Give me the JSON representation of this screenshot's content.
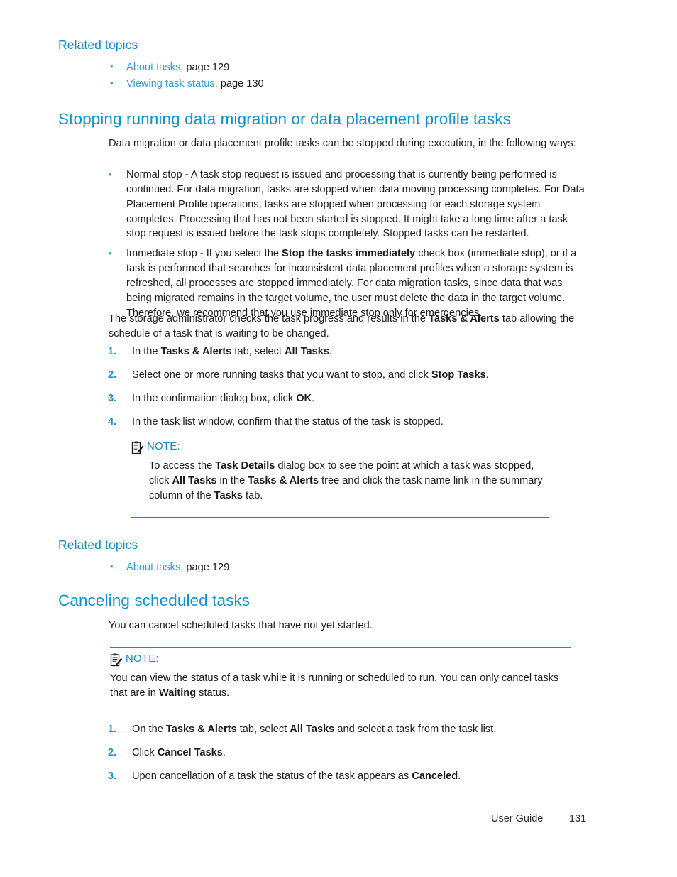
{
  "page": {
    "footer_label": "User Guide",
    "footer_page_number": "131"
  },
  "colors": {
    "heading_blue": "#0b95d4",
    "link_blue": "#2ba0dd",
    "rule_blue": "#0b8ecb",
    "step_number_blue": "#1a93d2",
    "body_text": "#1c1c1c"
  },
  "related_topics_top": {
    "heading": "Related topics",
    "items": [
      {
        "bullet": "•",
        "link": "About tasks",
        "suffix": ", page 129"
      },
      {
        "bullet": "•",
        "link": "Viewing task status",
        "suffix": ", page 130"
      }
    ]
  },
  "section_stopping": {
    "heading": "Stopping running data migration or data placement profile tasks",
    "intro": "Data migration or data placement profile tasks can be stopped during execution, in the following ways:",
    "bullets": [
      {
        "bullet": "•",
        "text": "Normal stop - A task stop request is issued and processing that is currently being performed is continued. For data migration, tasks are stopped when data moving processing completes. For Data Placement Profile operations, tasks are stopped when processing for each storage system completes. Processing that has not been started is stopped. It might take a long time after a task stop request is issued before the task stops completely. Stopped tasks can be restarted."
      },
      {
        "bullet": "•",
        "part1": "Immediate stop - If you select the ",
        "bold1": "Stop the tasks immediately",
        "part2": " check box (immediate stop), or if a task is performed that searches for inconsistent data placement profiles when a storage system is refreshed, all processes are stopped immediately. For data migration tasks, since data that was being migrated remains in the target volume, the user must delete the data in the target volume. Therefore, we recommend that you use immediate stop only for emergencies."
      }
    ],
    "paragraph": {
      "part1": "The storage administrator checks the task progress and results in the ",
      "bold1": "Tasks & Alerts",
      "part2": " tab allowing the schedule of a task that is waiting to be changed."
    },
    "steps": [
      {
        "num": "1.",
        "part1": "In the ",
        "bold1": "Tasks & Alerts",
        "part2": " tab, select ",
        "bold2": "All Tasks",
        "part3": "."
      },
      {
        "num": "2.",
        "part1": "Select one or more running tasks that you want to stop, and click ",
        "bold1": "Stop Tasks",
        "part2": "."
      },
      {
        "num": "3.",
        "part1": "In the confirmation dialog box, click ",
        "bold1": "OK",
        "part2": "."
      },
      {
        "num": "4.",
        "part1": "In the task list window, confirm that the status of the task is stopped.",
        "bold1": "",
        "part2": ""
      }
    ],
    "note": {
      "icon": "note-clipboard-icon",
      "label": "NOTE:",
      "part1": "To access the ",
      "bold1": "Task Details",
      "part2": " dialog box to see the point at which a task was stopped, click ",
      "bold2": "All Tasks",
      "part3": " in the ",
      "bold3": "Tasks & Alerts",
      "part4": " tree and click the task name link in the summary column of the ",
      "bold4": "Tasks",
      "part5": " tab."
    }
  },
  "related_topics_bottom": {
    "heading": "Related topics",
    "items": [
      {
        "bullet": "•",
        "link": "About tasks",
        "suffix": ", page 129"
      }
    ]
  },
  "section_canceling": {
    "heading": "Canceling scheduled tasks",
    "intro": "You can cancel scheduled tasks that have not yet started.",
    "note": {
      "icon": "note-clipboard-icon",
      "label": "NOTE:",
      "part1": "You can view the status of a task while it is running or scheduled to run. You can only cancel tasks that are in ",
      "bold1": "Waiting",
      "part2": " status."
    },
    "steps": [
      {
        "num": "1.",
        "part1": "On the ",
        "bold1": "Tasks & Alerts",
        "part2": " tab, select ",
        "bold2": "All Tasks",
        "part3": " and select a task from the task list."
      },
      {
        "num": "2.",
        "part1": "Click ",
        "bold1": "Cancel Tasks",
        "part2": "."
      },
      {
        "num": "3.",
        "part1": "Upon cancellation of a task the status of the task appears as ",
        "bold1": "Canceled",
        "part2": "."
      }
    ]
  }
}
